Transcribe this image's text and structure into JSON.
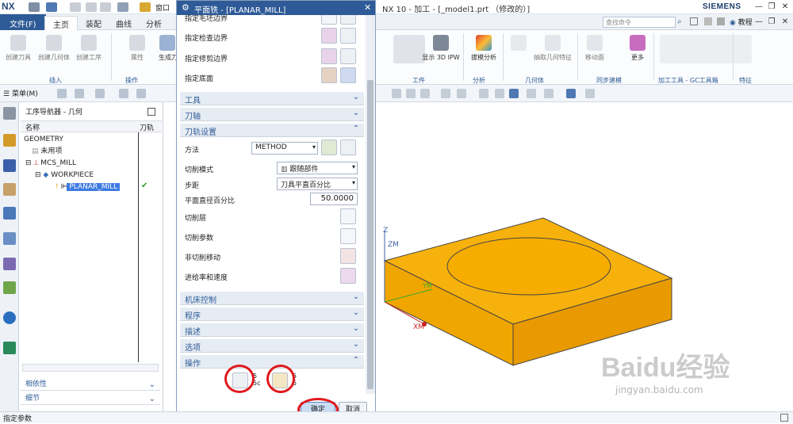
{
  "app": {
    "logo": "NX",
    "window_title": "NX 10 - 加工 - [_model1.prt （修改的）]",
    "brand": "SIEMENS",
    "left_title_fragment": "窗口"
  },
  "ribbon": {
    "tabs": [
      "文件(F)",
      "主页",
      "装配",
      "曲线",
      "分析"
    ],
    "search_placeholder": "查找命令",
    "tutorial": "教程",
    "left_buttons": [
      "创建刀具",
      "创建几何体",
      "创建工序",
      "属性",
      "生成刀"
    ],
    "left_groups": [
      "插入",
      "操作"
    ],
    "right_buttons": [
      "显示 3D IPW",
      "拔模分析",
      "抽取几何特征",
      "移动面",
      "更多"
    ],
    "right_groups": [
      "工件",
      "分析",
      "几何体",
      "同步建模",
      "加工工具 - GC工具箱",
      "特征"
    ]
  },
  "toolbar": {
    "menu_label": "菜单(M)"
  },
  "navigator": {
    "title": "工序导航器 - 几何",
    "col_name": "名称",
    "col_tool": "刀轨",
    "items": [
      {
        "label": "GEOMETRY",
        "indent": 0
      },
      {
        "label": "未用项",
        "indent": 1
      },
      {
        "label": "MCS_MILL",
        "indent": 1
      },
      {
        "label": "WORKPIECE",
        "indent": 2
      },
      {
        "label": "PLANAR_MILL",
        "indent": 3,
        "selected": true,
        "status": "✔"
      }
    ],
    "sections": [
      "相依性",
      "细节"
    ]
  },
  "dialog": {
    "title": "平面铣 - [PLANAR_MILL]",
    "boundary_rows": [
      "指定毛坯边界",
      "指定检查边界",
      "指定修剪边界",
      "指定底面"
    ],
    "collapsed_top": [
      "工具",
      "刀轴"
    ],
    "path_settings": {
      "header": "刀轨设置",
      "method_label": "方法",
      "method_value": "METHOD",
      "cut_pattern_label": "切削模式",
      "cut_pattern_value": "跟随部件",
      "stepover_label": "步距",
      "stepover_value": "刀具平直百分比",
      "percent_label": "平面直径百分比",
      "percent_value": "50.0000",
      "buttons": [
        "切削层",
        "切削参数",
        "非切削移动",
        "进给率和速度"
      ]
    },
    "collapsed_bottom": [
      "机床控制",
      "程序",
      "描述",
      "选项"
    ],
    "operations_header": "操作",
    "ok": "确定",
    "cancel": "取消"
  },
  "viewport": {
    "axis_labels": [
      "Z",
      "ZM",
      "YM",
      "XM"
    ]
  },
  "status": {
    "text": "指定参数"
  },
  "watermark": {
    "main": "Baidu经验",
    "sub": "jingyan.baidu.com"
  }
}
